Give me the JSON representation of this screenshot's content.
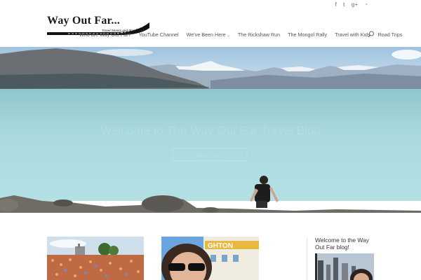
{
  "site": {
    "logo_title": "Way Out Far...",
    "logo_tagline": "Travel Stories and Road Trips"
  },
  "social": [
    {
      "icon": "facebook-icon",
      "glyph": "f"
    },
    {
      "icon": "twitter-icon",
      "glyph": "t"
    },
    {
      "icon": "google-plus-icon",
      "glyph": "g+"
    },
    {
      "icon": "rss-icon",
      "glyph": "◔"
    }
  ],
  "nav": {
    "items": [
      {
        "label": "Who are Way Out Far?"
      },
      {
        "label": "YouTube Channel"
      },
      {
        "label": "We've Been Here",
        "has_dropdown": true
      },
      {
        "label": "The Rickshaw Run"
      },
      {
        "label": "The Mongol Rally"
      },
      {
        "label": "Travel with Kids"
      },
      {
        "label": "Road Trips"
      }
    ]
  },
  "hero": {
    "title": "Welcome to The Way Out Far Travel Blog",
    "button": "Read More"
  },
  "sidebar": {
    "widget_title": "Welcome to the Way Out Far blog!"
  },
  "colors": {
    "lake": "#a7d8dd",
    "sky": "#bcd9ee",
    "text": "#666666"
  }
}
